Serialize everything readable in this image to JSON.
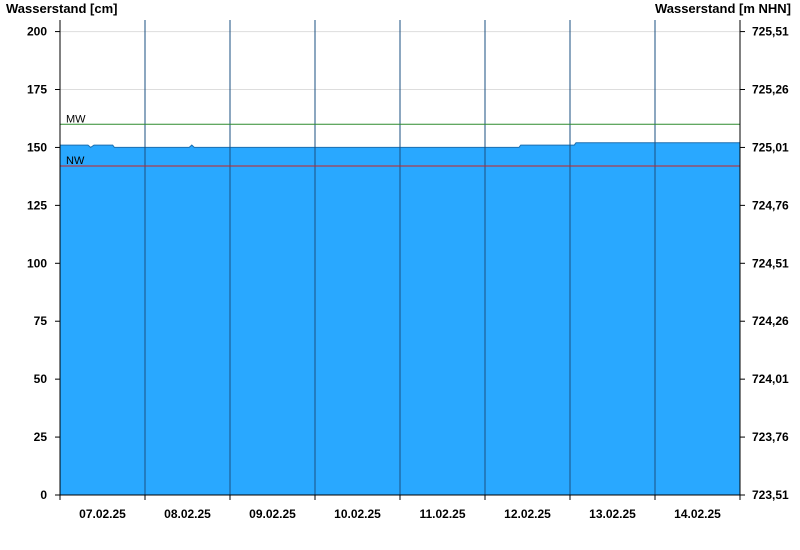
{
  "chart_data": {
    "type": "area",
    "left_axis": {
      "title": "Wasserstand [cm]",
      "ylim": [
        0,
        205
      ],
      "ticks": [
        0,
        25,
        50,
        75,
        100,
        125,
        150,
        175,
        200
      ],
      "tick_labels": [
        "0",
        "25",
        "50",
        "75",
        "100",
        "125",
        "150",
        "175",
        "200"
      ]
    },
    "right_axis": {
      "title": "Wasserstand [m NHN]",
      "tick_labels": [
        "723,51",
        "723,76",
        "724,01",
        "724,26",
        "724,51",
        "724,76",
        "725,01",
        "725,26",
        "725,51"
      ]
    },
    "x_axis": {
      "range_days": [
        0,
        8
      ],
      "date_labels": [
        "07.02.25",
        "08.02.25",
        "09.02.25",
        "10.02.25",
        "11.02.25",
        "12.02.25",
        "13.02.25",
        "14.02.25"
      ]
    },
    "grid": true,
    "series": {
      "color": "#29a8ff",
      "x_days": [
        0,
        0.33,
        0.36,
        0.4,
        0.62,
        0.64,
        1.52,
        1.55,
        1.58,
        2.0,
        3.0,
        4.0,
        5.0,
        5.4,
        5.42,
        6.0,
        6.05,
        6.07,
        7.0,
        8.0
      ],
      "y_cm": [
        151,
        151,
        150,
        151,
        151,
        150,
        150,
        151,
        150,
        150,
        150,
        150,
        150,
        150,
        151,
        151,
        151,
        152,
        152,
        152
      ]
    },
    "reference_lines": [
      {
        "label": "MW",
        "value": 160,
        "color": "#2e8b2e"
      },
      {
        "label": "NW",
        "value": 142,
        "color": "#cc2222"
      }
    ]
  }
}
